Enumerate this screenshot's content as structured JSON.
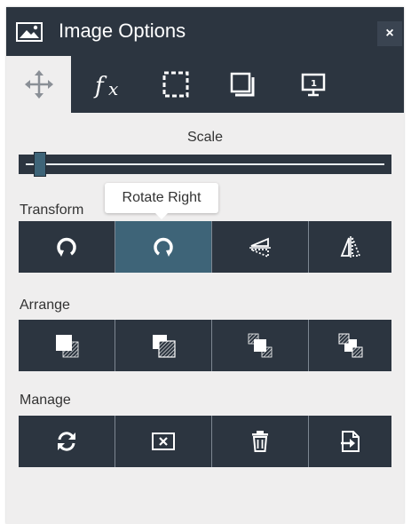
{
  "window": {
    "title": "Image Options",
    "close_label": "×"
  },
  "tabs": [
    {
      "icon": "move-icon",
      "active": true
    },
    {
      "icon": "effects-fx-icon",
      "active": false
    },
    {
      "icon": "crop-selection-icon",
      "active": false
    },
    {
      "icon": "shadow-icon",
      "active": false
    },
    {
      "icon": "presentation-icon",
      "active": false
    }
  ],
  "scale": {
    "label": "Scale",
    "value_fraction": 0.03
  },
  "tooltip": {
    "text": "Rotate Right"
  },
  "transform": {
    "label": "Transform",
    "buttons": [
      "rotate-left-icon",
      "rotate-right-icon",
      "flip-vertical-icon",
      "flip-horizontal-icon"
    ],
    "highlighted": "rotate-right-icon"
  },
  "arrange": {
    "label": "Arrange",
    "buttons": [
      "bring-to-front-icon",
      "send-to-back-icon",
      "bring-forward-icon",
      "send-backward-icon"
    ]
  },
  "manage": {
    "label": "Manage",
    "buttons": [
      "replace-image-icon",
      "remove-background-icon",
      "delete-icon",
      "export-icon"
    ]
  },
  "colors": {
    "panel_dark": "#2c3540",
    "highlight": "#3e6478",
    "panel_bg": "#efeeee"
  }
}
